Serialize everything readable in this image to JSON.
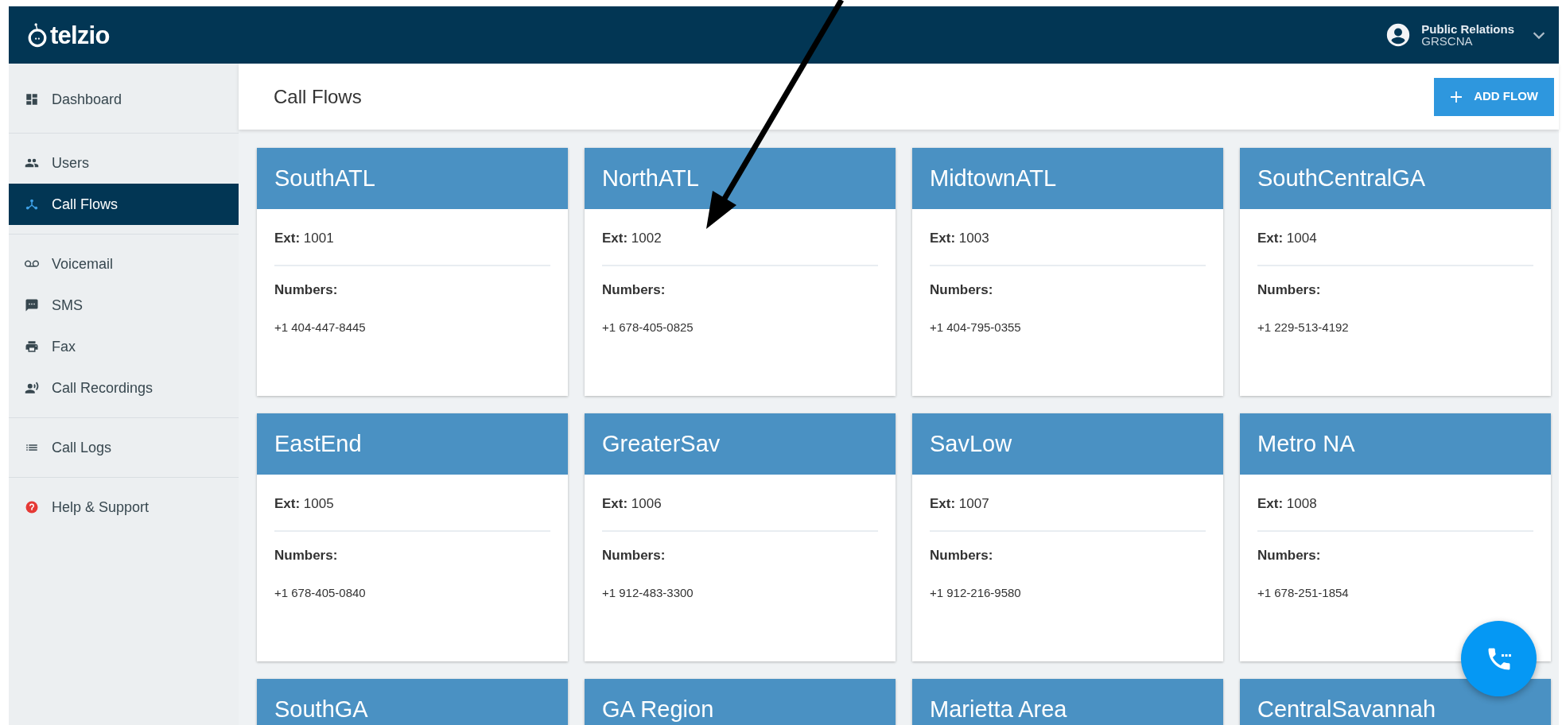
{
  "header": {
    "logo": "telzio",
    "user": {
      "name": "Public Relations",
      "org": "GRSCNA"
    }
  },
  "sidebar": {
    "sections": [
      [
        {
          "label": "Dashboard",
          "selected": false
        }
      ],
      [
        {
          "label": "Users",
          "selected": false
        },
        {
          "label": "Call Flows",
          "selected": true
        }
      ],
      [
        {
          "label": "Voicemail",
          "selected": false
        },
        {
          "label": "SMS",
          "selected": false
        },
        {
          "label": "Fax",
          "selected": false
        },
        {
          "label": "Call Recordings",
          "selected": false
        }
      ],
      [
        {
          "label": "Call Logs",
          "selected": false
        }
      ],
      [
        {
          "label": "Help & Support",
          "selected": false
        }
      ]
    ]
  },
  "page": {
    "title": "Call Flows",
    "add_button": "ADD FLOW"
  },
  "flows": [
    {
      "name": "SouthATL",
      "ext_label": "Ext:",
      "ext": "1001",
      "numbers_label": "Numbers:",
      "numbers": [
        "+1 404-447-8445"
      ]
    },
    {
      "name": "NorthATL",
      "ext_label": "Ext:",
      "ext": "1002",
      "numbers_label": "Numbers:",
      "numbers": [
        "+1 678-405-0825"
      ]
    },
    {
      "name": "MidtownATL",
      "ext_label": "Ext:",
      "ext": "1003",
      "numbers_label": "Numbers:",
      "numbers": [
        "+1 404-795-0355"
      ]
    },
    {
      "name": "SouthCentralGA",
      "ext_label": "Ext:",
      "ext": "1004",
      "numbers_label": "Numbers:",
      "numbers": [
        "+1 229-513-4192"
      ]
    },
    {
      "name": "EastEnd",
      "ext_label": "Ext:",
      "ext": "1005",
      "numbers_label": "Numbers:",
      "numbers": [
        "+1 678-405-0840"
      ]
    },
    {
      "name": "GreaterSav",
      "ext_label": "Ext:",
      "ext": "1006",
      "numbers_label": "Numbers:",
      "numbers": [
        "+1 912-483-3300"
      ]
    },
    {
      "name": "SavLow",
      "ext_label": "Ext:",
      "ext": "1007",
      "numbers_label": "Numbers:",
      "numbers": [
        "+1 912-216-9580"
      ]
    },
    {
      "name": "Metro NA",
      "ext_label": "Ext:",
      "ext": "1008",
      "numbers_label": "Numbers:",
      "numbers": [
        "+1 678-251-1854"
      ]
    },
    {
      "name": "SouthGA"
    },
    {
      "name": "GA Region"
    },
    {
      "name": "Marietta Area"
    },
    {
      "name": "CentralSavannah"
    }
  ]
}
